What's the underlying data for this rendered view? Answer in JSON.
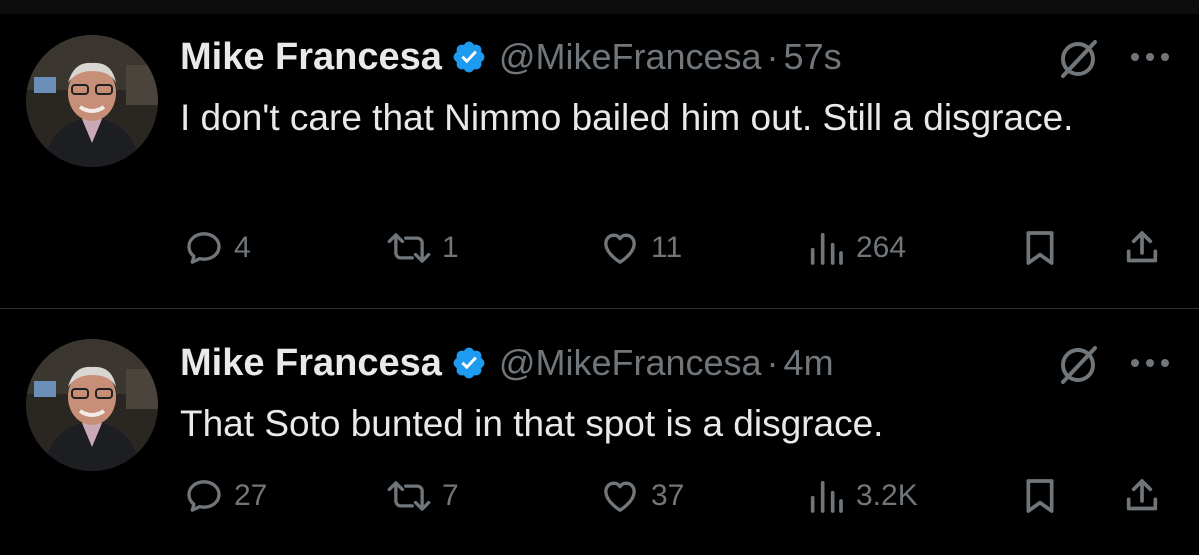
{
  "tweets": [
    {
      "author_name": "Mike Francesa",
      "handle": "@MikeFrancesa",
      "separator": "·",
      "time": "57s",
      "text": "I don't care that Nimmo bailed him out. Still a disgrace.",
      "replies": "4",
      "reposts": "1",
      "likes": "11",
      "views": "264"
    },
    {
      "author_name": "Mike Francesa",
      "handle": "@MikeFrancesa",
      "separator": "·",
      "time": "4m",
      "text": "That Soto bunted in that spot is a disgrace.",
      "replies": "27",
      "reposts": "7",
      "likes": "37",
      "views": "3.2K"
    }
  ],
  "colors": {
    "background": "#000000",
    "text_primary": "#e7e9ea",
    "text_secondary": "#71767b",
    "verified_badge": "#1d9bf0",
    "divider": "#2f3336"
  },
  "icons": [
    "verified-badge-icon",
    "grok-icon",
    "more-icon",
    "reply-icon",
    "repost-icon",
    "like-icon",
    "views-icon",
    "bookmark-icon",
    "share-icon"
  ]
}
